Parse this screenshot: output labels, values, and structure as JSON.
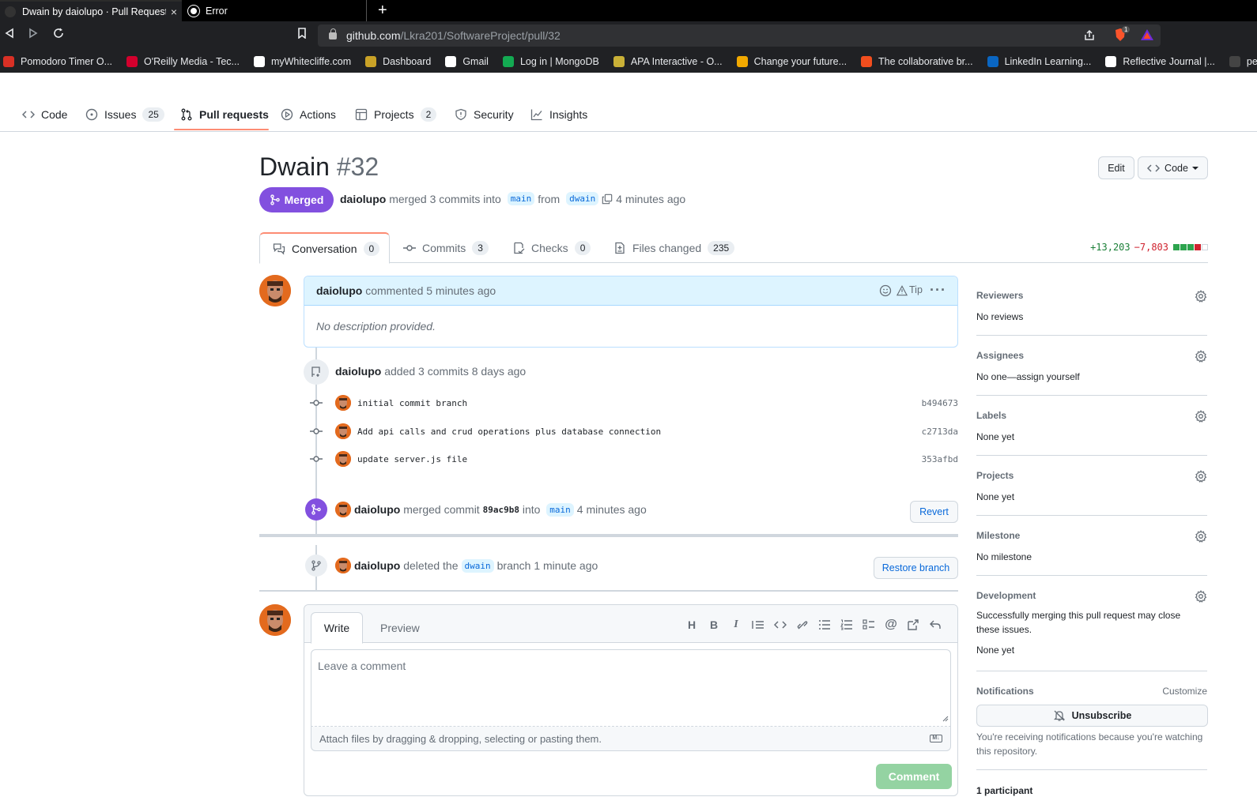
{
  "browser": {
    "tabs": [
      {
        "title": "Dwain by daiolupo · Pull Request",
        "close": "×"
      },
      {
        "title": "Error"
      }
    ],
    "new_tab": "+",
    "url_host": "github.com",
    "url_path": "/Lkra201/SoftwareProject/pull/32",
    "brave_badge": "1",
    "bookmarks": [
      {
        "label": "Pomodoro Timer O...",
        "color": "#d93025"
      },
      {
        "label": "O'Reilly Media - Tec...",
        "color": "#d3002d"
      },
      {
        "label": "myWhitecliffe.com",
        "color": "#ffffff"
      },
      {
        "label": "Dashboard",
        "color": "#c9a227"
      },
      {
        "label": "Gmail",
        "color": "#ffffff"
      },
      {
        "label": "Log in | MongoDB",
        "color": "#13aa52"
      },
      {
        "label": "APA Interactive - O...",
        "color": "#c9b037"
      },
      {
        "label": "Change your future...",
        "color": "#f2a900"
      },
      {
        "label": "The collaborative br...",
        "color": "#f24e1e"
      },
      {
        "label": "LinkedIn Learning...",
        "color": "#0a66c2"
      },
      {
        "label": "Reflective Journal |...",
        "color": "#ffffff"
      },
      {
        "label": "personal-refl",
        "color": "#444444"
      }
    ]
  },
  "repo_nav": {
    "code": "Code",
    "issues": "Issues",
    "issues_count": "25",
    "pulls": "Pull requests",
    "actions": "Actions",
    "projects": "Projects",
    "projects_count": "2",
    "security": "Security",
    "insights": "Insights"
  },
  "pr": {
    "title": "Dwain",
    "number": "#32",
    "edit": "Edit",
    "code_btn": "Code",
    "state": "Merged",
    "author": "daiolupo",
    "summary": "merged 3 commits into",
    "base": "main",
    "from": "from",
    "head": "dwain",
    "time": "4 minutes ago"
  },
  "pr_tabs": {
    "conversation": "Conversation",
    "conversation_count": "0",
    "commits": "Commits",
    "commits_count": "3",
    "checks": "Checks",
    "checks_count": "0",
    "files": "Files changed",
    "files_count": "235",
    "additions": "+13,203",
    "deletions": "−7,803"
  },
  "comment": {
    "author": "daiolupo",
    "action": "commented 5 minutes ago",
    "tip": "Tip",
    "body": "No description provided."
  },
  "commits_event": {
    "author": "daiolupo",
    "text": "added 3 commits 8 days ago",
    "items": [
      {
        "message": "initial commit branch",
        "sha": "b494673"
      },
      {
        "message": "Add api calls and crud operations plus database connection",
        "sha": "c2713da"
      },
      {
        "message": "update server.js file",
        "sha": "353afbd"
      }
    ]
  },
  "merge_event": {
    "author": "daiolupo",
    "text": "merged commit",
    "sha": "89ac9b8",
    "into": "into",
    "branch": "main",
    "time": "4 minutes ago",
    "revert": "Revert"
  },
  "delete_event": {
    "author": "daiolupo",
    "text": "deleted the",
    "branch": "dwain",
    "suffix": "branch 1 minute ago",
    "restore": "Restore branch"
  },
  "composer": {
    "write": "Write",
    "preview": "Preview",
    "placeholder": "Leave a comment",
    "attach": "Attach files by dragging & dropping, selecting or pasting them.",
    "md_badge": "M↓",
    "submit": "Comment"
  },
  "sidebar": {
    "reviewers": {
      "label": "Reviewers",
      "value": "No reviews"
    },
    "assignees": {
      "label": "Assignees",
      "value": "No one—",
      "link": "assign yourself"
    },
    "labels": {
      "label": "Labels",
      "value": "None yet"
    },
    "projects": {
      "label": "Projects",
      "value": "None yet"
    },
    "milestone": {
      "label": "Milestone",
      "value": "No milestone"
    },
    "development": {
      "label": "Development",
      "desc": "Successfully merging this pull request may close these issues.",
      "value": "None yet"
    },
    "notifications": {
      "label": "Notifications",
      "customize": "Customize",
      "unsubscribe": "Unsubscribe",
      "desc": "You're receiving notifications because you're watching this repository."
    },
    "participants": "1 participant"
  },
  "colors": {
    "merged": "#8250df",
    "accent": "#0969da",
    "tab_underline": "#fd8c73",
    "comment_btn": "#94d3a2"
  }
}
